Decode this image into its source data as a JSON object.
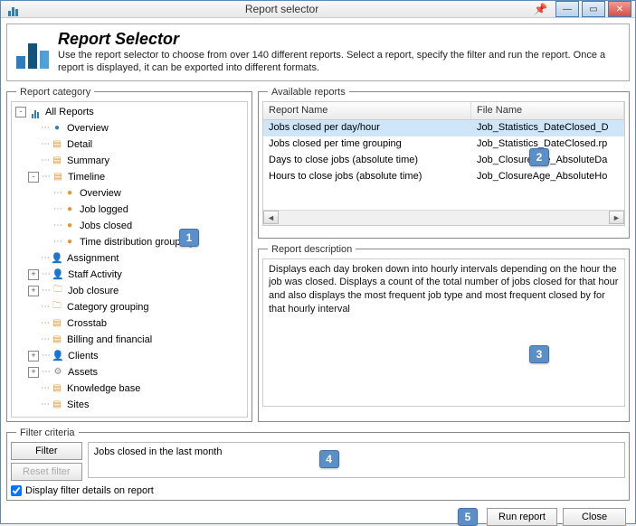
{
  "window": {
    "title": "Report selector"
  },
  "header": {
    "title": "Report Selector",
    "subtitle": "Use the report selector to choose from over 140 different reports.  Select a report, specify the filter and run the report.  Once a report is displayed, it can be exported into different formats."
  },
  "category": {
    "legend": "Report category",
    "tree": {
      "root": "All Reports",
      "items": [
        {
          "label": "Overview",
          "icon": "dot-blue"
        },
        {
          "label": "Detail",
          "icon": "page"
        },
        {
          "label": "Summary",
          "icon": "page"
        },
        {
          "label": "Timeline",
          "icon": "page",
          "expanded": true,
          "children": [
            {
              "label": "Overview",
              "icon": "dot-orange"
            },
            {
              "label": "Job logged",
              "icon": "dot-orange"
            },
            {
              "label": "Jobs closed",
              "icon": "dot-orange",
              "selected": true
            },
            {
              "label": "Time distribution grouping",
              "icon": "dot-orange"
            }
          ]
        },
        {
          "label": "Assignment",
          "icon": "person"
        },
        {
          "label": "Staff Activity",
          "icon": "person"
        },
        {
          "label": "Job closure",
          "icon": "folder"
        },
        {
          "label": "Category grouping",
          "icon": "folder"
        },
        {
          "label": "Crosstab",
          "icon": "page"
        },
        {
          "label": "Billing and financial",
          "icon": "page"
        },
        {
          "label": "Clients",
          "icon": "person"
        },
        {
          "label": "Assets",
          "icon": "gear"
        },
        {
          "label": "Knowledge base",
          "icon": "page"
        },
        {
          "label": "Sites",
          "icon": "page"
        }
      ]
    }
  },
  "available": {
    "legend": "Available reports",
    "cols": {
      "name": "Report Name",
      "file": "File Name"
    },
    "rows": [
      {
        "name": "Jobs closed per day/hour",
        "file": "Job_Statistics_DateClosed_D",
        "selected": true
      },
      {
        "name": "Jobs closed per time grouping",
        "file": "Job_Statistics_DateClosed.rp"
      },
      {
        "name": "Days to close jobs (absolute time)",
        "file": "Job_ClosureAge_AbsoluteDa"
      },
      {
        "name": "Hours to close jobs (absolute time)",
        "file": "Job_ClosureAge_AbsoluteHo"
      }
    ]
  },
  "description": {
    "legend": "Report description",
    "text": "Displays each day broken down into hourly intervals depending on the hour the job was closed. Displays a count of the total number of jobs closed for that hour and also displays the most frequent job type and most frequent closed by for that hourly interval"
  },
  "filter": {
    "legend": "Filter criteria",
    "filter_btn": "Filter",
    "reset_btn": "Reset filter",
    "text": "Jobs closed in the last month",
    "checkbox_label": "Display filter details on report",
    "checkbox_checked": true
  },
  "footer": {
    "run": "Run report",
    "close": "Close"
  },
  "callouts": {
    "c1": "1",
    "c2": "2",
    "c3": "3",
    "c4": "4",
    "c5": "5"
  }
}
